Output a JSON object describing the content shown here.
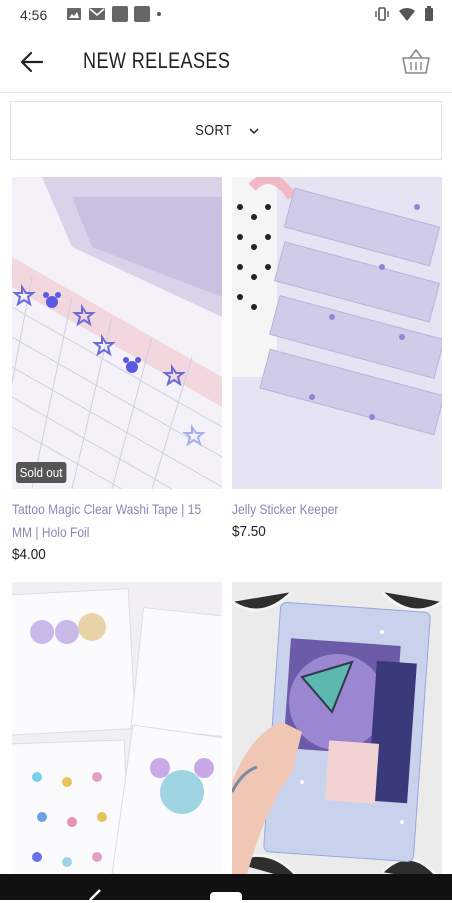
{
  "status": {
    "time": "4:56"
  },
  "header": {
    "title": "NEW RELEASES"
  },
  "sort": {
    "label": "SORT"
  },
  "products": [
    {
      "title": "Tattoo Magic Clear Washi Tape | 15 MM | Holo Foil",
      "price": "$4.00",
      "badge": "Sold out"
    },
    {
      "title": "Jelly Sticker Keeper",
      "price": "$7.50"
    },
    {
      "title": "",
      "price": ""
    },
    {
      "title": "",
      "price": ""
    }
  ]
}
